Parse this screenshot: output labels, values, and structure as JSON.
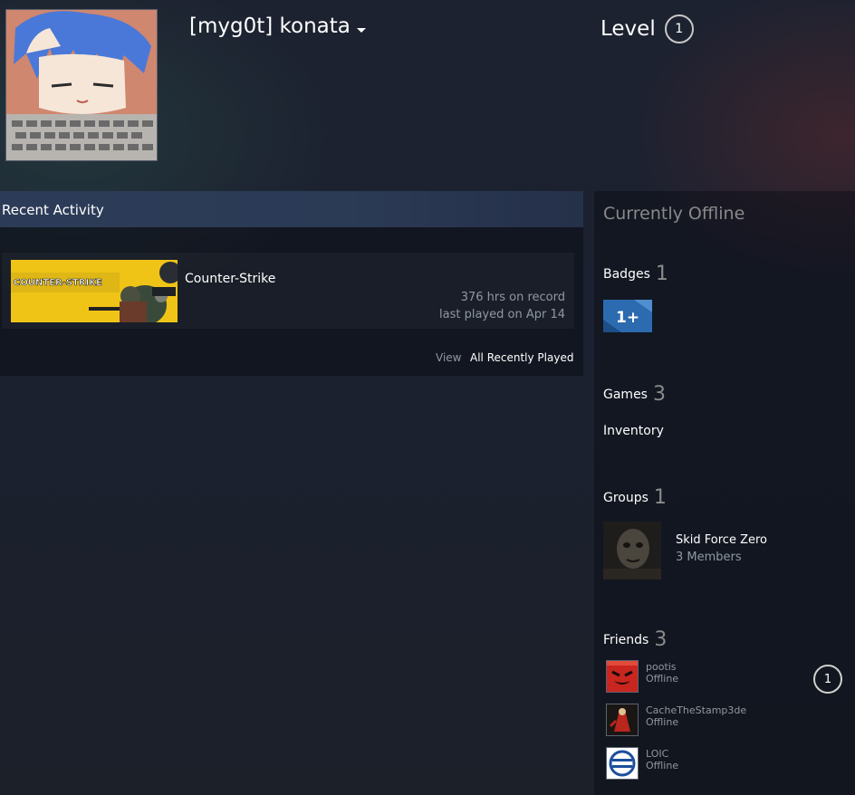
{
  "profile": {
    "persona_name": "[myg0t] konata",
    "level_label": "Level",
    "level_value": "1"
  },
  "recent_activity": {
    "title": "Recent Activity",
    "games": [
      {
        "name": "Counter-Strike",
        "banner_text": "COUNTER-STRIKE",
        "hours": "376 hrs on record",
        "last_played": "last played on Apr 14"
      }
    ],
    "view_label": "View",
    "view_link": "All Recently Played"
  },
  "sidebar": {
    "status": "Currently Offline",
    "badges": {
      "label": "Badges",
      "count": "1",
      "badge_text": "1+"
    },
    "games": {
      "label": "Games",
      "count": "3"
    },
    "inventory": {
      "label": "Inventory"
    },
    "groups": {
      "label": "Groups",
      "count": "1",
      "items": [
        {
          "name": "Skid Force Zero",
          "members": "3 Members"
        }
      ]
    },
    "friends": {
      "label": "Friends",
      "count": "3",
      "items": [
        {
          "name": "pootis",
          "status": "Offline"
        },
        {
          "name": "CacheTheStamp3de",
          "status": "Offline"
        },
        {
          "name": "LOIC",
          "status": "Offline",
          "level": "1"
        }
      ]
    }
  },
  "colors": {
    "background": "#1b2130",
    "recent_header": "#2c3c58",
    "text_muted": "#8f98a0",
    "badge_blue": "#2563a6"
  }
}
